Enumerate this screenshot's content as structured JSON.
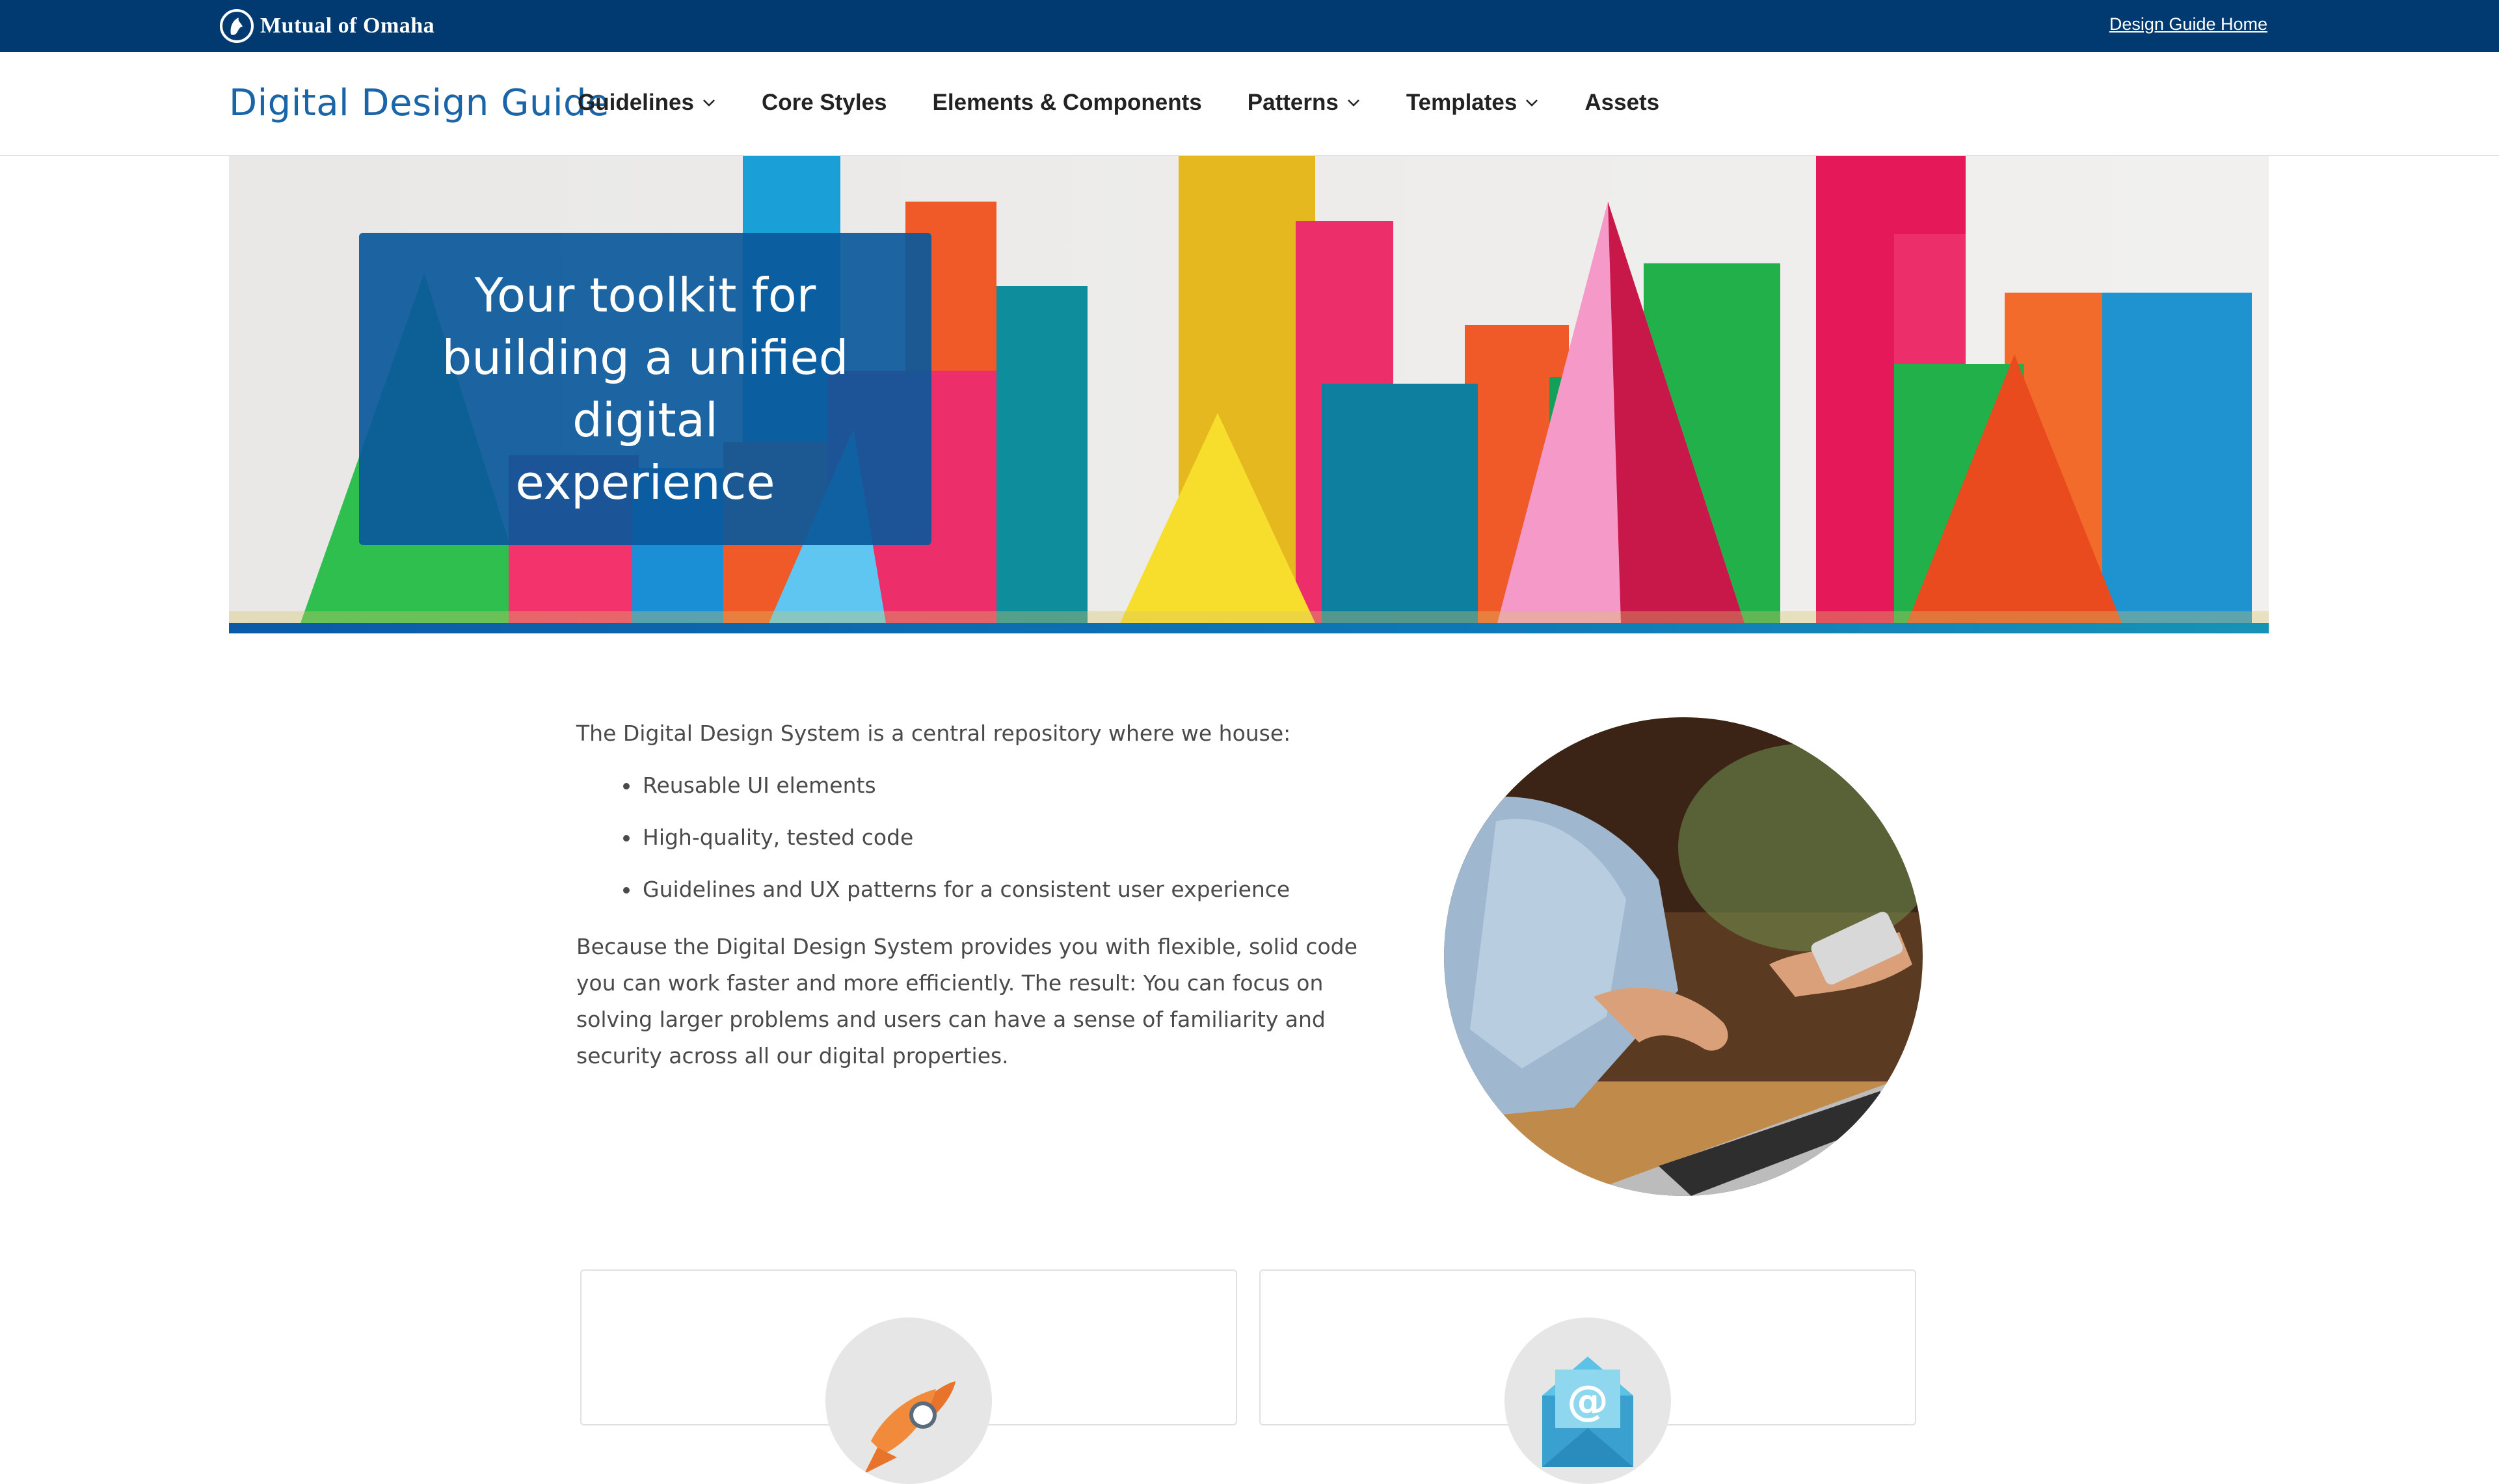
{
  "topbar": {
    "logo_text": "Mutual of Omaha",
    "home_link": "Design Guide Home"
  },
  "nav": {
    "brand": "Digital Design Guide",
    "items": [
      {
        "label": "Guidelines",
        "has_dropdown": true
      },
      {
        "label": "Core Styles",
        "has_dropdown": false
      },
      {
        "label": "Elements & Components",
        "has_dropdown": false
      },
      {
        "label": "Patterns",
        "has_dropdown": true
      },
      {
        "label": "Templates",
        "has_dropdown": true
      },
      {
        "label": "Assets",
        "has_dropdown": false
      }
    ]
  },
  "hero": {
    "title": "Your toolkit for building a unified digital experience",
    "image_icon": "colorful-paper-shapes-image"
  },
  "intro": {
    "lead": "The Digital Design System is a central repository where we house:",
    "bullets": [
      "Reusable UI elements",
      "High-quality, tested code",
      "Guidelines and UX patterns for a consistent user experience"
    ],
    "body": "Because the Digital Design System provides you with flexible, solid code you can work faster and more efficiently. The result: You can focus on solving larger problems and users can have a sense of familiarity and security across all our digital properties.",
    "photo_icon": "person-using-laptop-image"
  },
  "cards": [
    {
      "icon": "rocket-icon"
    },
    {
      "icon": "email-at-icon"
    }
  ],
  "colors": {
    "topbar": "#003a70",
    "brand": "#1a64a8",
    "hero_callout": "#0a589b",
    "accent_strip": "#0e78b6"
  }
}
